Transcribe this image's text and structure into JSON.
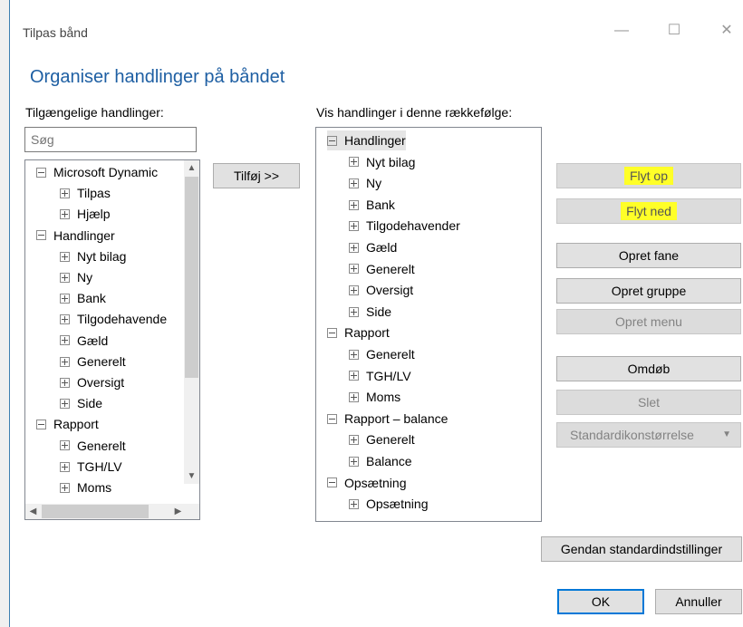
{
  "window": {
    "title": "Tilpas bånd",
    "minimize_glyph": "—",
    "maximize_glyph": "☐",
    "close_glyph": "✕"
  },
  "heading": "Organiser handlinger på båndet",
  "available": {
    "label": "Tilgængelige handlinger:",
    "search_placeholder": "Søg",
    "items": [
      {
        "label": "Microsoft Dynamic",
        "level": 0,
        "expanded": true
      },
      {
        "label": "Tilpas",
        "level": 1,
        "expanded": false
      },
      {
        "label": "Hjælp",
        "level": 1,
        "expanded": false
      },
      {
        "label": "Handlinger",
        "level": 0,
        "expanded": true
      },
      {
        "label": "Nyt bilag",
        "level": 1,
        "expanded": false
      },
      {
        "label": "Ny",
        "level": 1,
        "expanded": false
      },
      {
        "label": "Bank",
        "level": 1,
        "expanded": false
      },
      {
        "label": "Tilgodehavende",
        "level": 1,
        "expanded": false
      },
      {
        "label": "Gæld",
        "level": 1,
        "expanded": false
      },
      {
        "label": "Generelt",
        "level": 1,
        "expanded": false
      },
      {
        "label": "Oversigt",
        "level": 1,
        "expanded": false
      },
      {
        "label": "Side",
        "level": 1,
        "expanded": false
      },
      {
        "label": "Rapport",
        "level": 0,
        "expanded": true
      },
      {
        "label": "Generelt",
        "level": 1,
        "expanded": false
      },
      {
        "label": "TGH/LV",
        "level": 1,
        "expanded": false
      },
      {
        "label": "Moms",
        "level": 1,
        "expanded": false
      }
    ]
  },
  "add_button": "Tilføj >>",
  "order": {
    "label": "Vis handlinger i denne rækkefølge:",
    "items": [
      {
        "label": "Handlinger",
        "level": 0,
        "expanded": true,
        "selected": true
      },
      {
        "label": "Nyt bilag",
        "level": 1,
        "expanded": false
      },
      {
        "label": "Ny",
        "level": 1,
        "expanded": false
      },
      {
        "label": "Bank",
        "level": 1,
        "expanded": false
      },
      {
        "label": "Tilgodehavender",
        "level": 1,
        "expanded": false
      },
      {
        "label": "Gæld",
        "level": 1,
        "expanded": false
      },
      {
        "label": "Generelt",
        "level": 1,
        "expanded": false
      },
      {
        "label": "Oversigt",
        "level": 1,
        "expanded": false
      },
      {
        "label": "Side",
        "level": 1,
        "expanded": false
      },
      {
        "label": "Rapport",
        "level": 0,
        "expanded": true
      },
      {
        "label": "Generelt",
        "level": 1,
        "expanded": false
      },
      {
        "label": "TGH/LV",
        "level": 1,
        "expanded": false
      },
      {
        "label": "Moms",
        "level": 1,
        "expanded": false
      },
      {
        "label": "Rapport – balance",
        "level": 0,
        "expanded": true
      },
      {
        "label": "Generelt",
        "level": 1,
        "expanded": false
      },
      {
        "label": "Balance",
        "level": 1,
        "expanded": false
      },
      {
        "label": "Opsætning",
        "level": 0,
        "expanded": true
      },
      {
        "label": "Opsætning",
        "level": 1,
        "expanded": false
      }
    ]
  },
  "buttons": {
    "move_up": "Flyt op",
    "move_down": "Flyt ned",
    "create_tab": "Opret fane",
    "create_group": "Opret gruppe",
    "create_menu": "Opret menu",
    "rename": "Omdøb",
    "delete": "Slet",
    "icon_size": "Standardikonstørrelse",
    "restore": "Gendan standardindstillinger",
    "ok": "OK",
    "cancel": "Annuller"
  },
  "colors": {
    "heading": "#1e5fa3",
    "highlight": "#ffff28",
    "default_button_border": "#0078d7"
  }
}
